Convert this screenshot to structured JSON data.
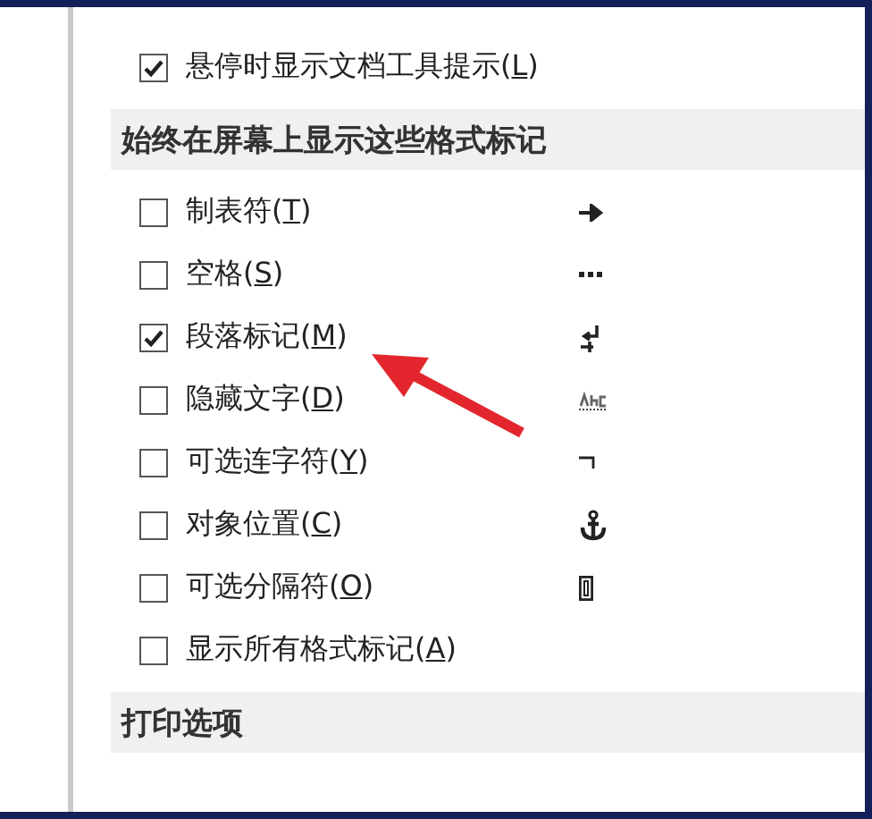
{
  "top_option": {
    "before": "悬停时显示文档工具提示(",
    "key": "L",
    "after": ")",
    "checked": true
  },
  "sections": [
    {
      "title": "始终在屏幕上显示这些格式标记",
      "options": [
        {
          "before": "制表符(",
          "key": "T",
          "after": ")",
          "checked": false,
          "kind": "tab"
        },
        {
          "before": "空格(",
          "key": "S",
          "after": ")",
          "checked": false,
          "kind": "space"
        },
        {
          "before": "段落标记(",
          "key": "M",
          "after": ")",
          "checked": true,
          "kind": "paragraph"
        },
        {
          "before": "隐藏文字(",
          "key": "D",
          "after": ")",
          "checked": false,
          "kind": "hidden"
        },
        {
          "before": "可选连字符(",
          "key": "Y",
          "after": ")",
          "checked": false,
          "kind": "hyphen"
        },
        {
          "before": "对象位置(",
          "key": "C",
          "after": ")",
          "checked": false,
          "kind": "anchor"
        },
        {
          "before": "可选分隔符(",
          "key": "O",
          "after": ")",
          "checked": false,
          "kind": "break"
        },
        {
          "before": "显示所有格式标记(",
          "key": "A",
          "after": ")",
          "checked": false,
          "kind": "plain"
        }
      ]
    },
    {
      "title": "打印选项"
    }
  ]
}
